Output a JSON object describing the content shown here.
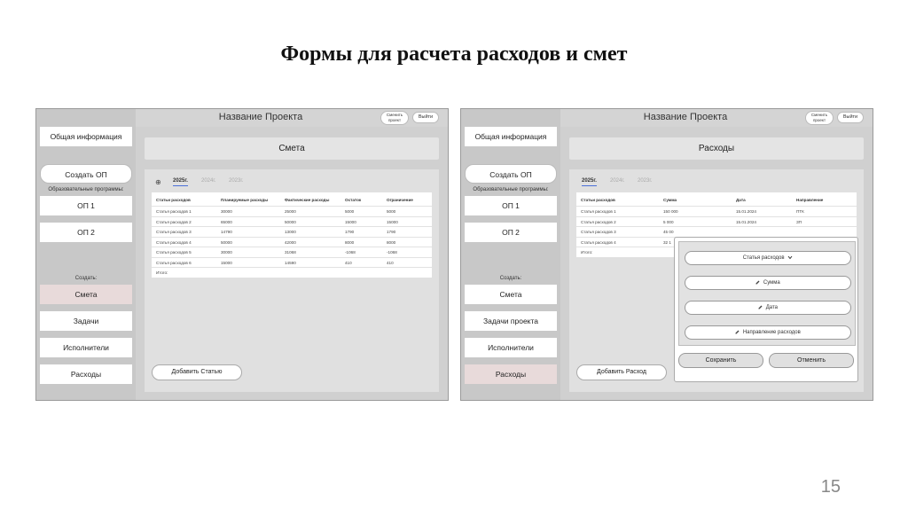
{
  "slide": {
    "title": "Формы для расчета расходов и смет",
    "page_number": "15"
  },
  "left_mockup": {
    "project_title": "Название Проекта",
    "switch_project": "Сменить проект",
    "exit": "Выйти",
    "sidebar": {
      "general_info": "Общая информация",
      "create_op": "Создать ОП",
      "programs_label": "Образовательные программы:",
      "op1": "ОП 1",
      "op2": "ОП 2",
      "create_label": "Создать:",
      "items": [
        "Смета",
        "Задачи",
        "Исполнители",
        "Расходы"
      ]
    },
    "header": "Смета",
    "plus_icon": "⊕",
    "years": [
      "2025г.",
      "2024г.",
      "2023г."
    ],
    "table": {
      "columns": [
        "Статьи расходов",
        "Планируемые расходы",
        "Фактические расходы",
        "Остаток",
        "Ограничение"
      ],
      "rows": [
        [
          "Статья расходов 1",
          "30000",
          "25000",
          "5000",
          "5000"
        ],
        [
          "Статья расходов 2",
          "65000",
          "50000",
          "15000",
          "15000"
        ],
        [
          "Статья расходов 3",
          "14790",
          "13000",
          "1790",
          "1790"
        ],
        [
          "Статья расходов 4",
          "50000",
          "42000",
          "8000",
          "8000"
        ],
        [
          "Статья расходов 5",
          "30000",
          "31068",
          "-1068",
          "-1068"
        ],
        [
          "Статья расходов 6",
          "15000",
          "14590",
          "410",
          "410"
        ]
      ],
      "total_label": "Итого:"
    },
    "add_button": "Добавить Статью"
  },
  "right_mockup": {
    "project_title": "Название Проекта",
    "switch_project": "Сменить проект",
    "exit": "Выйти",
    "sidebar": {
      "general_info": "Общая информация",
      "create_op": "Создать ОП",
      "programs_label": "Образовательные программы:",
      "op1": "ОП 1",
      "op2": "ОП 2",
      "create_label": "Создать:",
      "items": [
        "Смета",
        "Задачи проекта",
        "Исполнители",
        "Расходы"
      ]
    },
    "header": "Расходы",
    "years": [
      "2025г.",
      "2024г.",
      "2023г."
    ],
    "table": {
      "columns": [
        "Статьи расходов",
        "Сумма",
        "Дата",
        "Направление"
      ],
      "rows": [
        [
          "Статья расходов 1",
          "150 000",
          "15.01.2024",
          "ПТК"
        ],
        [
          "Статья расходов 2",
          "5 000",
          "15.01.2024",
          "ЗП"
        ],
        [
          "Статья расходов 3",
          "45 00",
          "",
          ""
        ],
        [
          "Статья расходов 4",
          "32 1",
          "",
          ""
        ]
      ],
      "total_label": "Итого:"
    },
    "add_button": "Добавить Расход",
    "modal": {
      "category": "Статья расходов",
      "category_icon": "chevron-down-icon",
      "amount": "Сумма",
      "date": "Дата",
      "direction": "Направление расходов",
      "edit_icon": "pencil-icon",
      "save": "Сохранить",
      "cancel": "Отменить"
    }
  }
}
